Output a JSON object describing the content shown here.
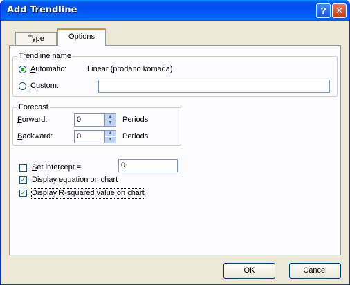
{
  "window": {
    "title": "Add Trendline",
    "help_icon": "?",
    "close_icon": "✕"
  },
  "tabs": [
    {
      "label": "Type"
    },
    {
      "label": "Options"
    }
  ],
  "trendline_name": {
    "legend": "Trendline name",
    "automatic": {
      "letter": "A",
      "rest": "utomatic:",
      "value": "Linear (prodano komada)",
      "selected": true
    },
    "custom": {
      "letter": "C",
      "rest": "ustom:",
      "value": "",
      "selected": false
    }
  },
  "forecast": {
    "legend": "Forecast",
    "forward": {
      "letter": "F",
      "rest": "orward:",
      "value": "0",
      "unit": "Periods"
    },
    "backward": {
      "letter": "B",
      "rest": "ackward:",
      "value": "0",
      "unit": "Periods"
    }
  },
  "options": {
    "set_intercept": {
      "letter": "S",
      "rest": "et intercept =",
      "checked": false,
      "value": "0"
    },
    "display_equation": {
      "pre": "Display ",
      "letter": "e",
      "rest": "quation on chart",
      "checked": true
    },
    "display_rsquared": {
      "pre": "Display ",
      "letter": "R",
      "rest": "-squared value on chart",
      "checked": true
    }
  },
  "buttons": {
    "ok": "OK",
    "cancel": "Cancel"
  }
}
